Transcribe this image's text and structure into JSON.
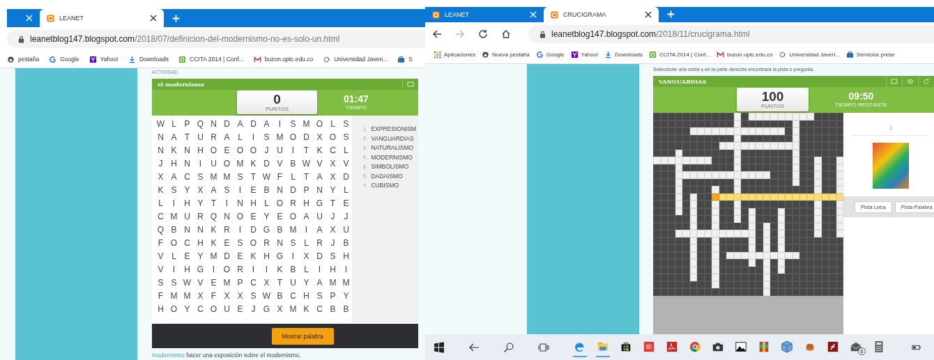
{
  "left_window": {
    "tabs": [
      {
        "selected": false
      },
      {
        "title": "LEANET",
        "selected": true
      }
    ],
    "address": {
      "host": "leanetblog147.blogspot.com",
      "path": "/2018/07/definicion-del-modernismo-no-es-solo-un.html"
    },
    "bookmarks": [
      {
        "kind": "newtab",
        "label": "pestaña"
      },
      {
        "kind": "google",
        "label": "Google"
      },
      {
        "kind": "yahoo",
        "label": "Yahoo!"
      },
      {
        "kind": "download",
        "label": "Downloads"
      },
      {
        "kind": "ccita",
        "label": "CCITA 2014 | Conf..."
      },
      {
        "kind": "gmail",
        "label": "buzon.uptc.edu.co"
      },
      {
        "kind": "university",
        "label": "Universidad Javeri..."
      },
      {
        "kind": "briefcase",
        "label": "S"
      }
    ],
    "page": {
      "section_label": "ACTIVIDAD",
      "game": {
        "title": "el modernismo",
        "score": "0",
        "score_label": "PUNTOS",
        "time": "01:47",
        "time_label": "TIEMPO",
        "letter_rows": [
          "W L P Q N D A D A I S M O L S",
          "N A T U R A L I S M O D X O S",
          "N K N H O E O O J U I T K C L",
          "J H N I U O M K D V B W V X V",
          "X A C S M M S T W F L T A X D",
          "K S Y X A S I E B N D P N Y L",
          "L I H Y T I N H L O R H G T E",
          "C M U R Q N O E Y E O A U J J",
          "Q B N N K R I D G B M I A X U",
          "F O C H K E S O R N S L R J B",
          "V L E Y M D E K H G I X D S H",
          "V I H G I O R I I K B L I H I",
          "S S W V E M P C X T U Y A M M",
          "F M M X F X X S W B C H S P Y",
          "H O Y C O U E J G X M K C B B"
        ],
        "words": [
          {
            "number": "1.",
            "word": "EXPRESIONISM"
          },
          {
            "number": "2.",
            "word": "VANGUARDIAS"
          },
          {
            "number": "3.",
            "word": "NATURALISMO"
          },
          {
            "number": "4.",
            "word": "MODERNISMO"
          },
          {
            "number": "5.",
            "word": "SIMBOLISMO"
          },
          {
            "number": "6.",
            "word": "DADAISMO"
          },
          {
            "number": "7.",
            "word": "CUBISMO"
          }
        ],
        "reveal_button": "Mostrar palabra"
      },
      "footer": {
        "link": "modernismo",
        "text": "hacer una exposición sobre el modernismo."
      }
    }
  },
  "right_window": {
    "tabs": [
      {
        "title": "LEANET",
        "selected": false
      },
      {
        "title": "CRUCIGRAMA",
        "selected": true
      }
    ],
    "navigation": {
      "forward_disabled": true
    },
    "address": {
      "host": "leanetblog147.blogspot.com",
      "path": "/2018/11/crucigrama.html"
    },
    "bookmarks": [
      {
        "kind": "apps",
        "label": "Aplicaciones"
      },
      {
        "kind": "newtab",
        "label": "Nueva pestaña"
      },
      {
        "kind": "google",
        "label": "Google"
      },
      {
        "kind": "yahoo",
        "label": "Yahoo!"
      },
      {
        "kind": "download",
        "label": "Downloads"
      },
      {
        "kind": "ccita",
        "label": "CCITA 2014 | Conf..."
      },
      {
        "kind": "gmail",
        "label": "buzon.uptc.edu.co"
      },
      {
        "kind": "university",
        "label": "Universidad Javeri..."
      },
      {
        "kind": "briefcase",
        "label": "Servicios prese"
      }
    ],
    "page": {
      "instruction": "Seleccione una celda y en la parte derecha encontrara la pista o pregunta.",
      "game": {
        "title": "VANGUARDIAS",
        "score": "100",
        "score_label": "PUNTOS",
        "time": "09:50",
        "time_label": "TIEMPO RESTANTE",
        "clue": {
          "number": "1"
        },
        "buttons": [
          "Pista Letra",
          "Pista Palabra"
        ]
      }
    }
  },
  "taskbar": {
    "apps": [
      {
        "kind": "edge",
        "running": true
      },
      {
        "kind": "explorer",
        "running": true
      },
      {
        "kind": "store",
        "running": false
      },
      {
        "kind": "red-app",
        "running": false
      },
      {
        "kind": "pdf",
        "running": false
      },
      {
        "kind": "chrome",
        "running": false
      },
      {
        "kind": "camera",
        "running": false
      },
      {
        "kind": "photos",
        "running": false
      },
      {
        "kind": "archive",
        "running": false
      },
      {
        "kind": "cube",
        "running": false
      },
      {
        "kind": "glove",
        "running": false
      },
      {
        "kind": "flash",
        "running": false
      },
      {
        "kind": "mail",
        "running": false,
        "badge": "6"
      },
      {
        "kind": "calculator",
        "running": false
      }
    ]
  }
}
